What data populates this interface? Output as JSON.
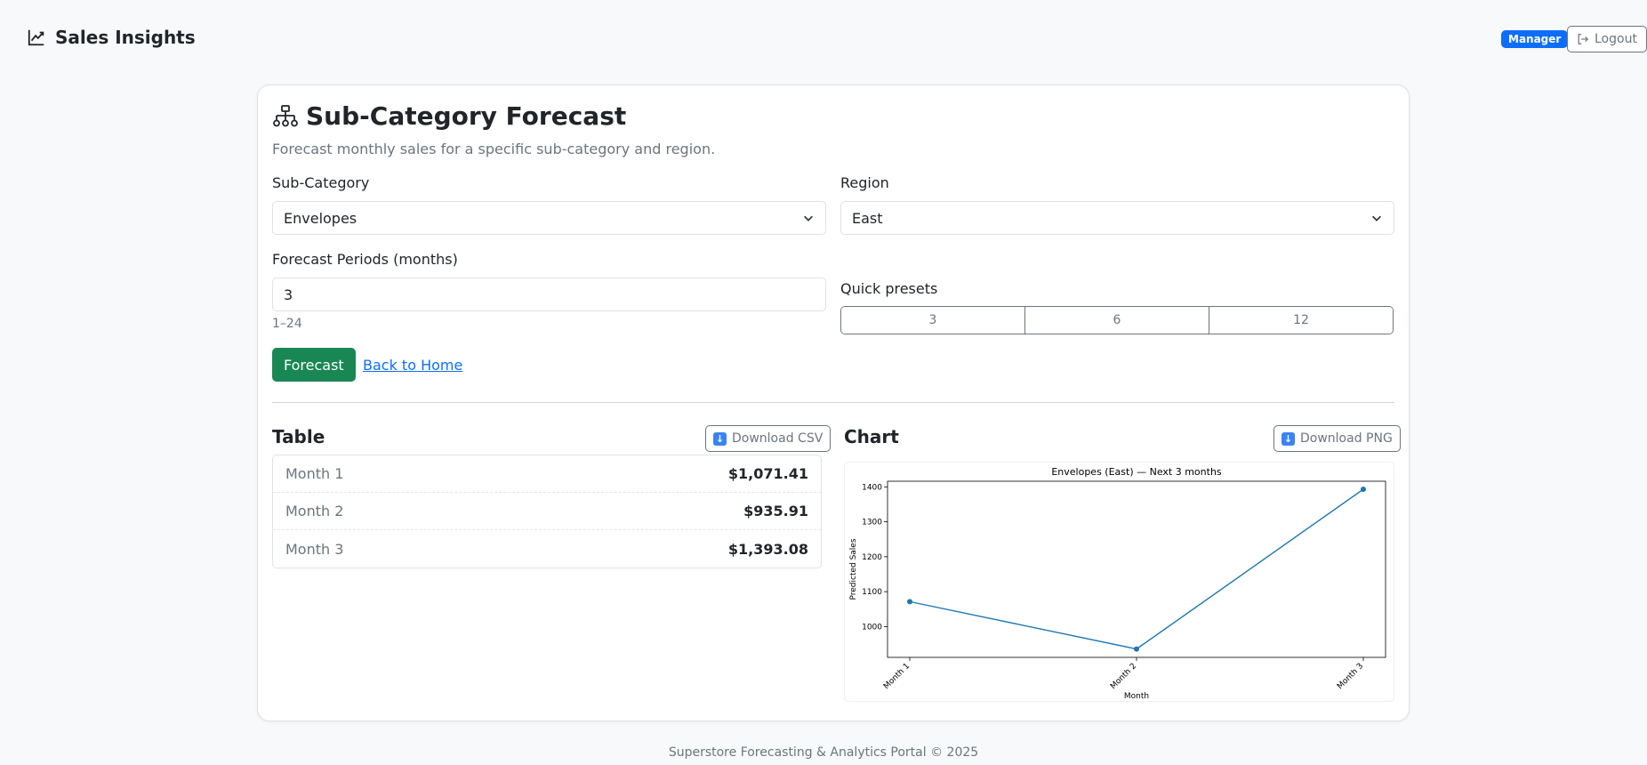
{
  "navbar": {
    "brand": "Sales Insights",
    "role_badge": "Manager",
    "logout_label": "Logout"
  },
  "page": {
    "title": "Sub-Category Forecast",
    "subtitle": "Forecast monthly sales for a specific sub-category and region."
  },
  "form": {
    "subcategory_label": "Sub-Category",
    "subcategory_value": "Envelopes",
    "region_label": "Region",
    "region_value": "East",
    "periods_label": "Forecast Periods (months)",
    "periods_value": "3",
    "periods_help": "1–24",
    "presets_label": "Quick presets",
    "presets": [
      "3",
      "6",
      "12"
    ],
    "forecast_button": "Forecast",
    "back_link": "Back to Home"
  },
  "table": {
    "title": "Table",
    "download_label": "Download CSV",
    "rows": [
      {
        "label": "Month 1",
        "value": "$1,071.41"
      },
      {
        "label": "Month 2",
        "value": "$935.91"
      },
      {
        "label": "Month 3",
        "value": "$1,393.08"
      }
    ]
  },
  "chart_section": {
    "title": "Chart",
    "download_label": "Download PNG"
  },
  "chart_data": {
    "type": "line",
    "title": "Envelopes (East) — Next 3 months",
    "xlabel": "Month",
    "ylabel": "Predicted Sales",
    "categories": [
      "Month 1",
      "Month 2",
      "Month 3"
    ],
    "series": [
      {
        "values": [
          1071.41,
          935.91,
          1393.08
        ]
      }
    ],
    "yticks": [
      1000,
      1100,
      1200,
      1300,
      1400
    ],
    "ylim": [
      912,
      1416
    ],
    "grid": false,
    "color": "#1f77b4"
  },
  "footer": {
    "text": "Superstore Forecasting & Analytics Portal © 2025"
  },
  "colors": {
    "primary": "#0d6efd",
    "success": "#198754",
    "muted": "#6c757d"
  }
}
